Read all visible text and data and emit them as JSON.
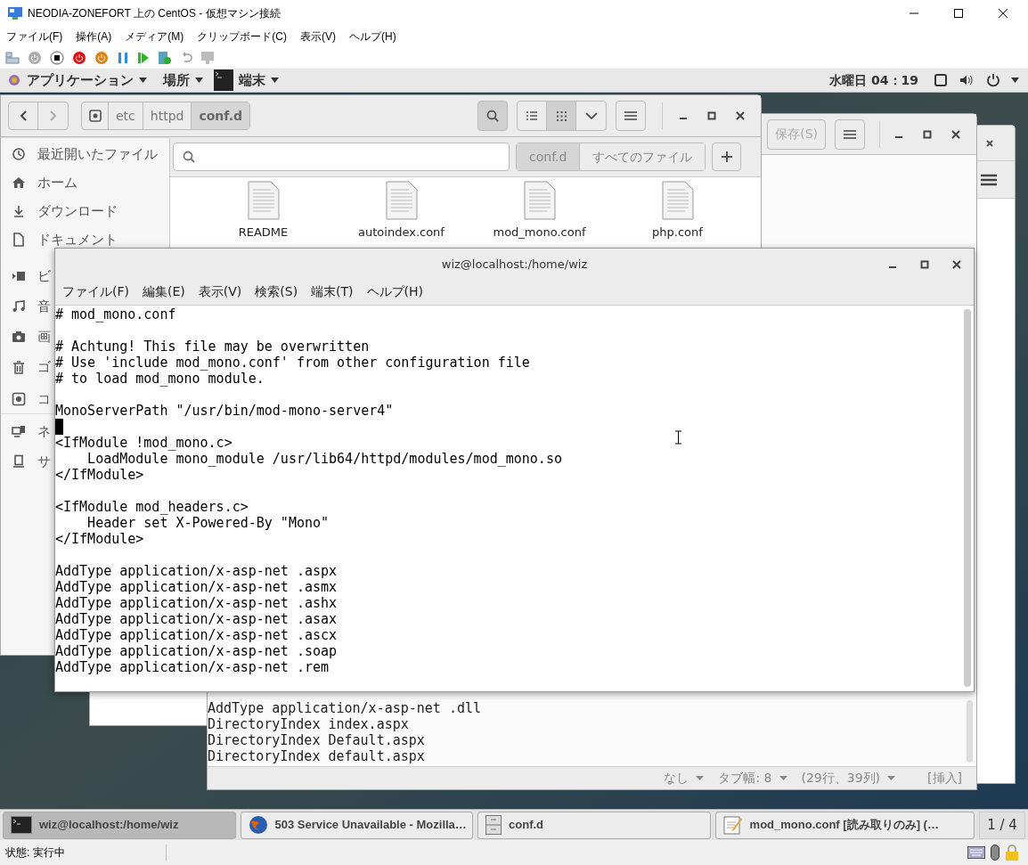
{
  "vm_window": {
    "title": "NEODIA-ZONEFORT 上の CentOS - 仮想マシン接続",
    "menu": [
      "ファイル(F)",
      "操作(A)",
      "メディア(M)",
      "クリップボード(C)",
      "表示(V)",
      "ヘルプ(H)"
    ],
    "status": "状態: 実行中"
  },
  "top_bar": {
    "applications": "アプリケーション",
    "places": "場所",
    "app": "端末",
    "clock": "水曜日 04：19"
  },
  "files_window": {
    "path": [
      {
        "label": "etc",
        "selected": false
      },
      {
        "label": "httpd",
        "selected": false
      },
      {
        "label": "conf.d",
        "selected": true
      }
    ],
    "view_modes": [
      {
        "kind": "list",
        "selected": false
      },
      {
        "kind": "grid",
        "selected": true
      }
    ],
    "sidebar": [
      {
        "kind": "recent",
        "label": "最近開いたファイル"
      },
      {
        "kind": "home",
        "label": "ホーム"
      },
      {
        "kind": "download",
        "label": "ダウンロード"
      },
      {
        "kind": "document",
        "label": "ドキュメント"
      },
      {
        "kind": "video",
        "label": "ビ"
      },
      {
        "kind": "music",
        "label": "音"
      },
      {
        "kind": "photo",
        "label": "画"
      },
      {
        "kind": "trash",
        "label": "ゴ"
      },
      {
        "kind": "drive",
        "label": "コ"
      },
      {
        "kind": "network",
        "label": "ネ"
      },
      {
        "kind": "server",
        "label": "サ"
      }
    ],
    "search_scope": [
      {
        "label": "conf.d",
        "selected": true
      },
      {
        "label": "すべてのファイル",
        "selected": false
      }
    ],
    "files": [
      "README",
      "autoindex.conf",
      "mod_mono.conf",
      "php.conf"
    ]
  },
  "editor_window": {
    "save_button": "保存(S)",
    "lines": [
      "AddType application/x-asp-net .dll",
      "DirectoryIndex index.aspx",
      "DirectoryIndex Default.aspx",
      "DirectoryIndex default.aspx"
    ],
    "status": [
      "なし",
      "タブ幅: 8",
      "(29行、39列)",
      "[挿入]"
    ]
  },
  "terminal": {
    "title": "wiz@localhost:/home/wiz",
    "menu": [
      "ファイル(F)",
      "編集(E)",
      "表示(V)",
      "検索(S)",
      "端末(T)",
      "ヘルプ(H)"
    ],
    "lines": [
      {
        "kind": "text",
        "text": "# mod_mono.conf"
      },
      {
        "kind": "blank"
      },
      {
        "kind": "text",
        "text": "# Achtung! This file may be overwritten"
      },
      {
        "kind": "text",
        "text": "# Use 'include mod_mono.conf' from other configuration file"
      },
      {
        "kind": "text",
        "text": "# to load mod_mono module."
      },
      {
        "kind": "blank"
      },
      {
        "kind": "text",
        "text": "MonoServerPath \"/usr/bin/mod-mono-server4\""
      },
      {
        "kind": "cursor"
      },
      {
        "kind": "text",
        "text": "<IfModule !mod_mono.c>"
      },
      {
        "kind": "text",
        "text": "    LoadModule mono_module /usr/lib64/httpd/modules/mod_mono.so"
      },
      {
        "kind": "text",
        "text": "</IfModule>"
      },
      {
        "kind": "blank"
      },
      {
        "kind": "text",
        "text": "<IfModule mod_headers.c>"
      },
      {
        "kind": "text",
        "text": "    Header set X-Powered-By \"Mono\""
      },
      {
        "kind": "text",
        "text": "</IfModule>"
      },
      {
        "kind": "blank"
      },
      {
        "kind": "text",
        "text": "AddType application/x-asp-net .aspx"
      },
      {
        "kind": "text",
        "text": "AddType application/x-asp-net .asmx"
      },
      {
        "kind": "text",
        "text": "AddType application/x-asp-net .ashx"
      },
      {
        "kind": "text",
        "text": "AddType application/x-asp-net .asax"
      },
      {
        "kind": "text",
        "text": "AddType application/x-asp-net .ascx"
      },
      {
        "kind": "text",
        "text": "AddType application/x-asp-net .soap"
      },
      {
        "kind": "text",
        "text": "AddType application/x-asp-net .rem"
      }
    ]
  },
  "taskbar": {
    "items": [
      {
        "kind": "terminal",
        "label": "wiz@localhost:/home/wiz",
        "selected": true
      },
      {
        "kind": "browser",
        "label": "503 Service Unavailable - Mozilla…",
        "selected": false
      },
      {
        "kind": "files",
        "label": "conf.d",
        "selected": false
      },
      {
        "kind": "editor",
        "label": "mod_mono.conf [読み取りのみ] (…",
        "selected": false
      }
    ],
    "pager": "1 / 4"
  }
}
